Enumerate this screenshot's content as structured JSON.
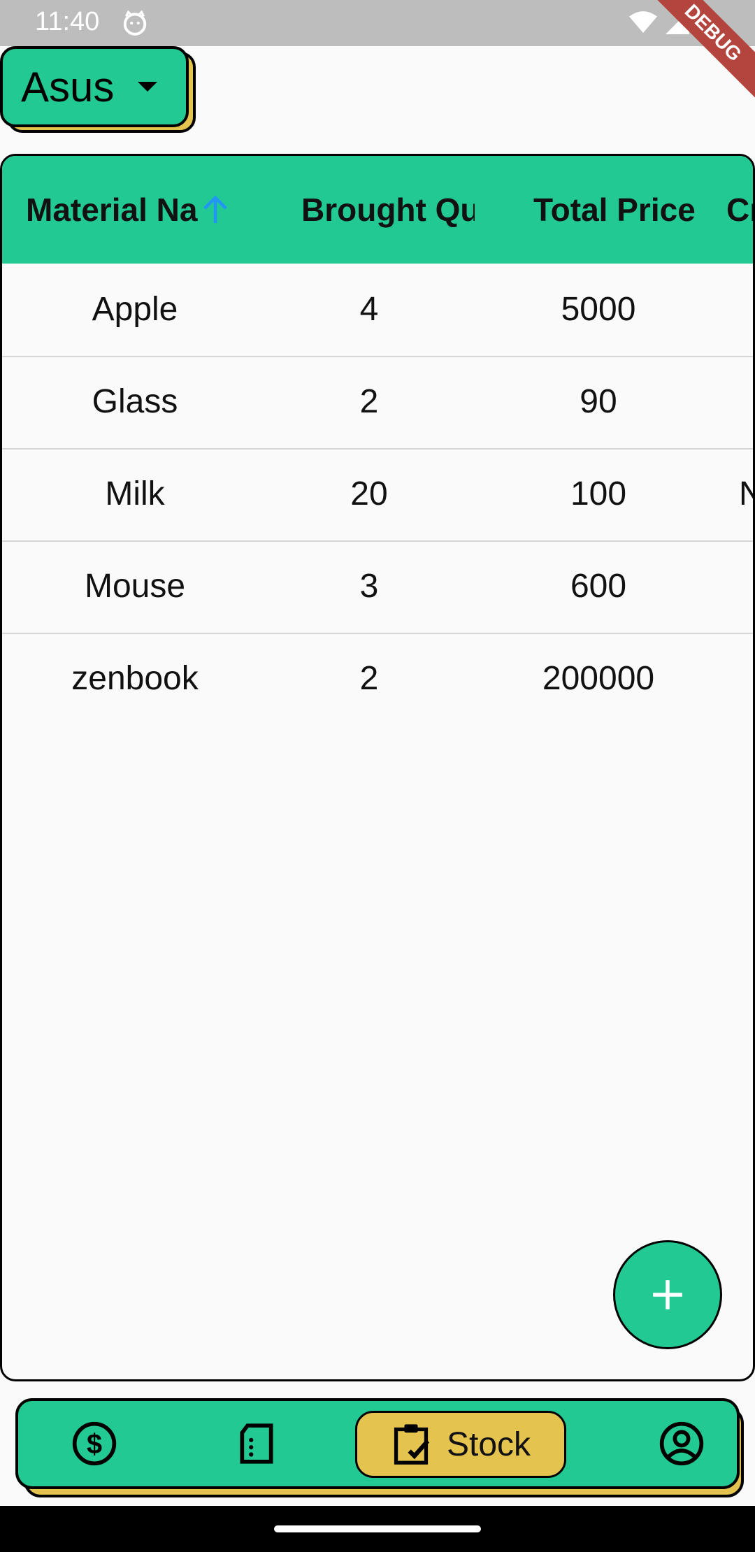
{
  "status_bar": {
    "time": "11:40"
  },
  "debug_banner": "DEBUG",
  "dropdown": {
    "selected": "Asus"
  },
  "table": {
    "columns": [
      "Material Na",
      "Brought Qu",
      "Total Price",
      "Cr"
    ],
    "rows": [
      [
        "Apple",
        "4",
        "5000",
        ""
      ],
      [
        "Glass",
        "2",
        "90",
        ""
      ],
      [
        "Milk",
        "20",
        "100",
        "N"
      ],
      [
        "Mouse",
        "3",
        "600",
        ""
      ],
      [
        "zenbook",
        "2",
        "200000",
        ""
      ]
    ]
  },
  "fab_icon": "plus-icon",
  "bottom_nav": {
    "items": [
      {
        "icon": "dollar-icon"
      },
      {
        "icon": "document-icon"
      },
      {
        "icon": "clipboard-check-icon",
        "label": "Stock",
        "selected": true
      },
      {
        "icon": "account-circle-icon"
      }
    ]
  },
  "colors": {
    "accent": "#22C993",
    "highlight": "#E5C34F",
    "sort_arrow": "#2196F3"
  }
}
